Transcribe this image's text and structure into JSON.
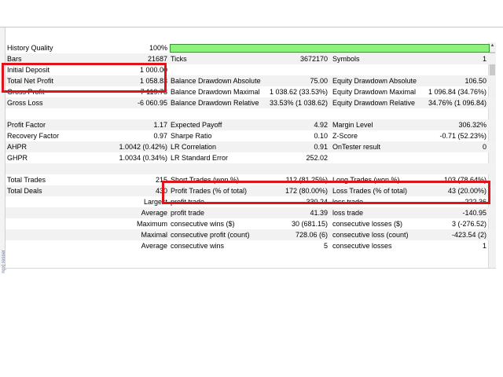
{
  "annotation_color": "#e0121b",
  "quality_bar_color": "#8cf27a",
  "side_label": "ngx| resser",
  "rows": [
    {
      "c0": "History Quality",
      "v0": "100%",
      "bar": true,
      "quality_percent": 100
    },
    {
      "c0": "Bars",
      "v0": "21687",
      "c1": "Ticks",
      "v1": "3672170",
      "c2": "Symbols",
      "v2": "1"
    },
    {
      "c0": "Initial Deposit",
      "v0": "1 000.00"
    },
    {
      "c0": "Total Net Profit",
      "v0": "1 058.83",
      "c1": "Balance Drawdown Absolute",
      "v1": "75.00",
      "c2": "Equity Drawdown Absolute",
      "v2": "106.50"
    },
    {
      "c0": "Gross Profit",
      "v0": "7 119.78",
      "c1": "Balance Drawdown Maximal",
      "v1": "1 038.62 (33.53%)",
      "c2": "Equity Drawdown Maximal",
      "v2": "1 096.84 (34.76%)"
    },
    {
      "c0": "Gross Loss",
      "v0": "-6 060.95",
      "c1": "Balance Drawdown Relative",
      "v1": "33.53% (1 038.62)",
      "c2": "Equity Drawdown Relative",
      "v2": "34.76% (1 096.84)"
    },
    {},
    {
      "c0": "Profit Factor",
      "v0": "1.17",
      "c1": "Expected Payoff",
      "v1": "4.92",
      "c2": "Margin Level",
      "v2": "306.32%"
    },
    {
      "c0": "Recovery Factor",
      "v0": "0.97",
      "c1": "Sharpe Ratio",
      "v1": "0.10",
      "c2": "Z-Score",
      "v2": "-0.71 (52.23%)"
    },
    {
      "c0": "AHPR",
      "v0": "1.0042 (0.42%)",
      "c1": "LR Correlation",
      "v1": "0.91",
      "c2": "OnTester result",
      "v2": "0"
    },
    {
      "c0": "GHPR",
      "v0": "1.0034 (0.34%)",
      "c1": "LR Standard Error",
      "v1": "252.02"
    },
    {},
    {
      "c0": "Total Trades",
      "v0": "215",
      "c1": "Short Trades (won %)",
      "v1": "112 (81.25%)",
      "c2": "Long Trades (won %)",
      "v2": "103 (78.64%)"
    },
    {
      "c0": "Total Deals",
      "v0": "430",
      "c1": "Profit Trades (% of total)",
      "v1": "172 (80.00%)",
      "c2": "Loss Trades (% of total)",
      "v2": "43 (20.00%)"
    },
    {
      "v0": "Largest",
      "c1": "profit trade",
      "v1": "330.24",
      "c2": "loss trade",
      "v2": "-222.36"
    },
    {
      "v0": "Average",
      "c1": "profit trade",
      "v1": "41.39",
      "c2": "loss trade",
      "v2": "-140.95"
    },
    {
      "v0": "Maximum",
      "c1": "consecutive wins ($)",
      "v1": "30 (681.15)",
      "c2": "consecutive losses ($)",
      "v2": "3 (-276.52)"
    },
    {
      "v0": "Maximal",
      "c1": "consecutive profit (count)",
      "v1": "728.06 (6)",
      "c2": "consecutive loss (count)",
      "v2": "-423.54 (2)"
    },
    {
      "v0": "Average",
      "c1": "consecutive wins",
      "v1": "5",
      "c2": "consecutive losses",
      "v2": "1"
    }
  ]
}
